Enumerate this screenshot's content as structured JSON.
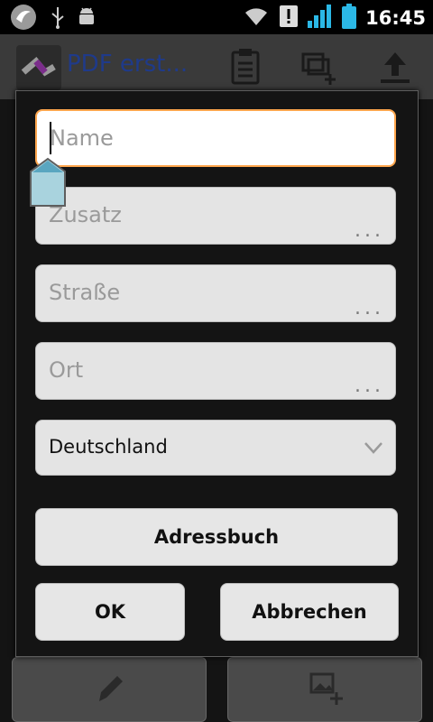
{
  "status_bar": {
    "time": "16:45",
    "icons": [
      "app-notification-icon",
      "usb-icon",
      "android-debug-icon",
      "wifi-icon",
      "alert-icon",
      "signal-icon",
      "battery-icon"
    ]
  },
  "app_bar": {
    "title": "PDF erst...",
    "icons": [
      "clipboard-icon",
      "add-layer-icon",
      "upload-icon"
    ]
  },
  "dialog": {
    "fields": [
      {
        "placeholder": "Name",
        "value": "",
        "focused": true
      },
      {
        "placeholder": "Zusatz",
        "value": ""
      },
      {
        "placeholder": "Straße",
        "value": ""
      },
      {
        "placeholder": "Ort",
        "value": ""
      }
    ],
    "country": "Deutschland",
    "addressbook_label": "Adressbuch",
    "ok_label": "OK",
    "cancel_label": "Abbrechen",
    "dots": "..."
  },
  "bottom_bar": {
    "icons": [
      "pencil-icon",
      "add-image-icon"
    ]
  },
  "colors": {
    "focus_border": "#ffa64d",
    "title_color": "#1f3a8a"
  }
}
